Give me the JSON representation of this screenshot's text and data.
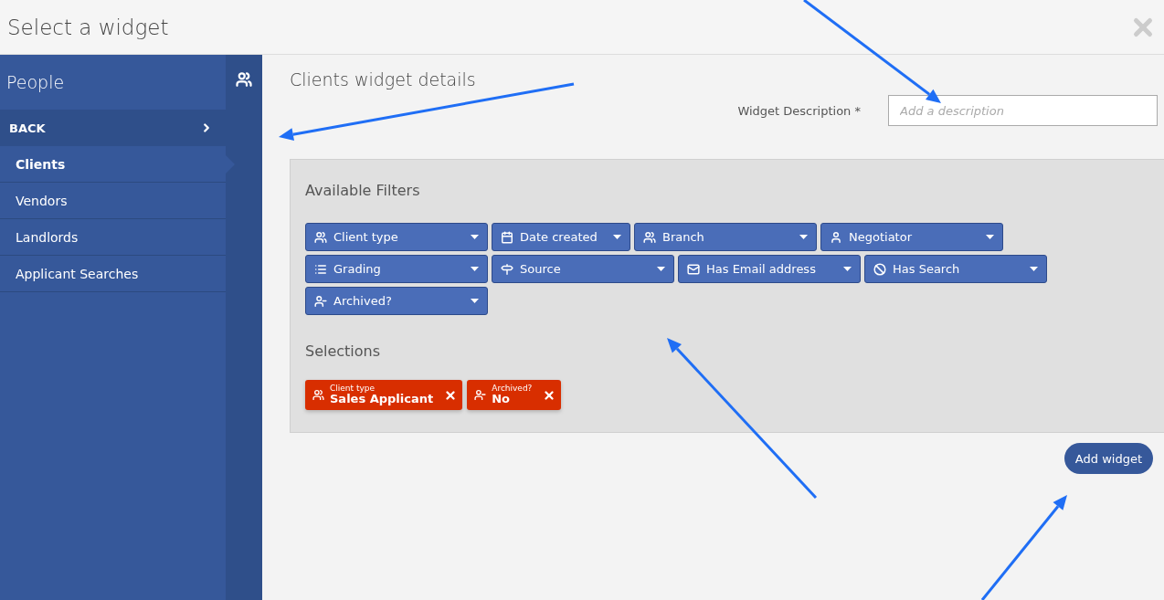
{
  "window": {
    "title": "Select a widget"
  },
  "sidebar": {
    "title": "People",
    "back": "BACK",
    "items": [
      {
        "label": "Clients",
        "selected": true
      },
      {
        "label": "Vendors",
        "selected": false
      },
      {
        "label": "Landlords",
        "selected": false
      },
      {
        "label": "Applicant Searches",
        "selected": false
      }
    ]
  },
  "main": {
    "heading": "Clients widget details",
    "description_label": "Widget Description *",
    "description": {
      "placeholder": "Add a description"
    }
  },
  "filters": {
    "title": "Available Filters",
    "items": [
      {
        "kind": "people",
        "label": "Client type"
      },
      {
        "kind": "calendar",
        "label": "Date created"
      },
      {
        "kind": "group",
        "label": "Branch"
      },
      {
        "kind": "person",
        "label": "Negotiator"
      },
      {
        "kind": "list",
        "label": "Grading"
      },
      {
        "kind": "signpost",
        "label": "Source"
      },
      {
        "kind": "mail",
        "label": "Has Email address"
      },
      {
        "kind": "ban",
        "label": "Has Search"
      },
      {
        "kind": "archived",
        "label": "Archived?"
      }
    ]
  },
  "selections": {
    "title": "Selections",
    "items": [
      {
        "kind": "people",
        "caption": "Client type",
        "value": "Sales Applicant"
      },
      {
        "kind": "archived",
        "caption": "Archived?",
        "value": "No"
      }
    ]
  },
  "add_button": "Add widget"
}
